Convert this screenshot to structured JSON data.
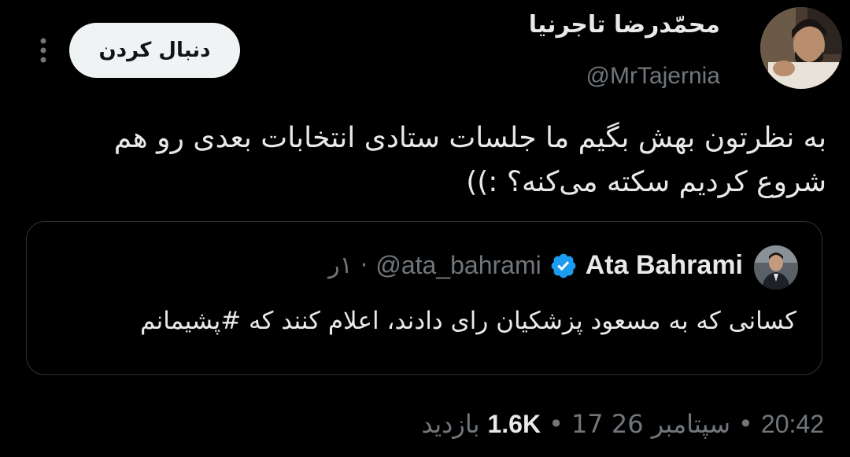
{
  "author": {
    "display_name": "محمّدرضا تاجرنیا",
    "handle": "@MrTajernia"
  },
  "follow_label": "دنبال کردن",
  "tweet": {
    "text": "به نظرتون بهش بگیم ما جلسات ستادی انتخابات بعدی رو هم شروع کردیم سکته می‌کنه؟ :))"
  },
  "quoted": {
    "name": "Ata Bahrami",
    "handle": "@ata_bahrami",
    "time": "۱ر",
    "verified": true,
    "text": "کسانی که به مسعود پزشکیان رای دادند، اعلام کنند که #پشیمانم"
  },
  "meta": {
    "time": "20:42",
    "date": "17 سپتامبر 26",
    "views_count": "1.6K",
    "views_label": "بازدید"
  },
  "colors": {
    "background": "#000000",
    "text_primary": "#e7e9ea",
    "text_secondary": "#71767b",
    "border": "#2f3336",
    "verified": "#1d9bf0",
    "button_bg": "#eff3f4"
  }
}
